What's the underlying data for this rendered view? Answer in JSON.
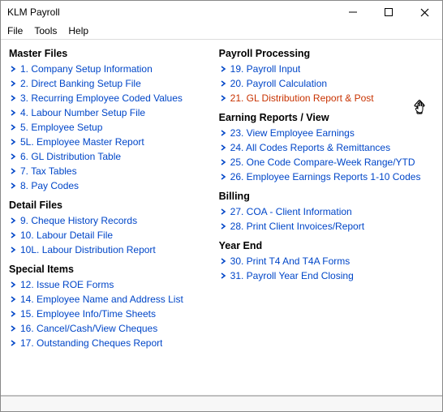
{
  "window": {
    "title": "KLM Payroll"
  },
  "menu": {
    "file": "File",
    "tools": "Tools",
    "help": "Help"
  },
  "left_sections": [
    {
      "heading": "Master Files",
      "items": [
        "1. Company Setup Information",
        "2. Direct Banking Setup File",
        "3. Recurring Employee Coded Values",
        "4. Labour Number Setup File",
        "5. Employee Setup",
        "5L. Employee Master Report",
        "6. GL Distribution Table",
        "7. Tax Tables",
        "8. Pay Codes"
      ]
    },
    {
      "heading": "Detail Files",
      "items": [
        "9. Cheque History Records",
        "10. Labour Detail File",
        "10L. Labour Distribution Report"
      ]
    },
    {
      "heading": "Special Items",
      "items": [
        "12. Issue ROE Forms",
        "14. Employee Name and Address List",
        "15. Employee Info/Time Sheets",
        "16. Cancel/Cash/View Cheques",
        "17. Outstanding Cheques Report"
      ]
    }
  ],
  "right_sections": [
    {
      "heading": "Payroll Processing",
      "items": [
        "19. Payroll Input",
        "20. Payroll Calculation",
        "21. GL Distribution Report & Post"
      ],
      "hovered_index": 2
    },
    {
      "heading": "Earning Reports / View",
      "items": [
        "23. View Employee Earnings",
        "24. All Codes Reports & Remittances",
        "25. One Code Compare-Week Range/YTD",
        "26. Employee Earnings Reports 1-10 Codes"
      ]
    },
    {
      "heading": "Billing",
      "items": [
        "27. COA - Client Information",
        "28. Print Client Invoices/Report"
      ]
    },
    {
      "heading": "Year End",
      "items": [
        "30. Print T4 And T4A Forms",
        "31. Payroll Year End Closing"
      ]
    }
  ]
}
